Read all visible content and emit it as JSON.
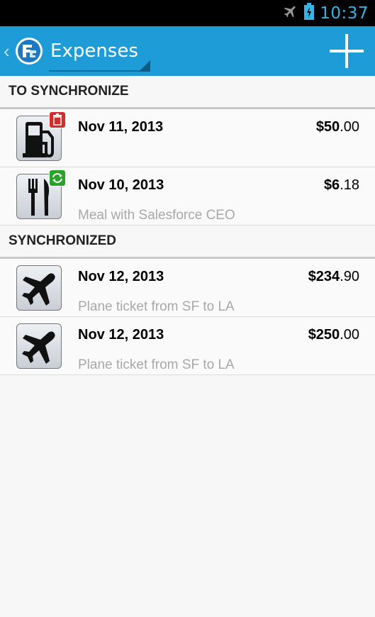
{
  "status_bar": {
    "time": "10:37",
    "icons": [
      "airplane-mode-icon",
      "battery-charging-icon"
    ]
  },
  "action_bar": {
    "title": "Expenses",
    "add_label": "+",
    "colors": {
      "background": "#1e9cd8",
      "title": "#ffffff"
    }
  },
  "sections": {
    "to_sync": {
      "header": "TO SYNCHRONIZE",
      "items": [
        {
          "date": "Nov 11, 2013",
          "amount_whole": "$50",
          "amount_frac": ".00",
          "description": "",
          "category_icon": "fuel-pump-icon",
          "badge_icon": "trash-badge-icon"
        },
        {
          "date": "Nov 10, 2013",
          "amount_whole": "$6",
          "amount_frac": ".18",
          "description": "Meal with Salesforce CEO",
          "category_icon": "fork-knife-icon",
          "badge_icon": "sync-badge-icon"
        }
      ]
    },
    "synced": {
      "header": "SYNCHRONIZED",
      "items": [
        {
          "date": "Nov 12, 2013",
          "amount_whole": "$234",
          "amount_frac": ".90",
          "description": "Plane ticket from SF to LA",
          "category_icon": "airplane-icon"
        },
        {
          "date": "Nov 12, 2013",
          "amount_whole": "$250",
          "amount_frac": ".00",
          "description": "Plane ticket from SF to LA",
          "category_icon": "airplane-icon"
        }
      ]
    }
  }
}
